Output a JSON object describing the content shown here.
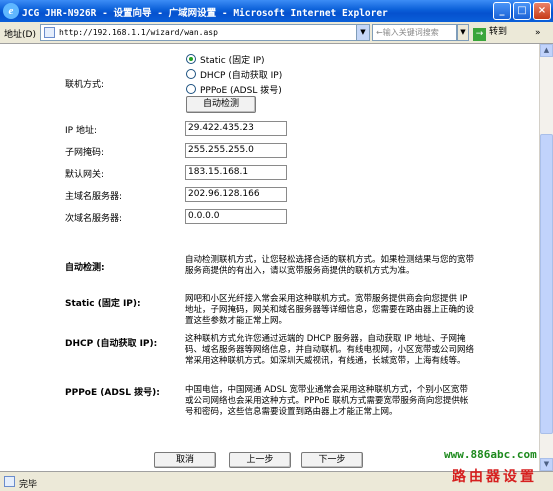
{
  "window": {
    "title": "JCG JHR-N926R - 设置向导 - 广域网设置 - Microsoft Internet Explorer",
    "minimize": "_",
    "maximize": "□",
    "close": "×"
  },
  "addressbar": {
    "label": "地址(D)",
    "url": "http://192.168.1.1/wizard/wan.asp",
    "dropdown": "▼",
    "search_placeholder": "←输入关键词搜索",
    "search_dropdown": "▼",
    "go_label": "转到",
    "go_arrow": "→",
    "more": "»"
  },
  "form": {
    "connection_mode_label": "联机方式:",
    "options": [
      {
        "label": "Static (固定 IP)",
        "checked": true
      },
      {
        "label": "DHCP (自动获取 IP)",
        "checked": false
      },
      {
        "label": "PPPoE (ADSL 拨号)",
        "checked": false
      }
    ],
    "auto_detect_button": "自动检测",
    "fields": [
      {
        "label": "IP 地址:",
        "value": "29.422.435.23"
      },
      {
        "label": "子网掩码:",
        "value": "255.255.255.0"
      },
      {
        "label": "默认网关:",
        "value": "183.15.168.1"
      },
      {
        "label": "主域名服务器:",
        "value": "202.96.128.166"
      },
      {
        "label": "次域名服务器:",
        "value": "0.0.0.0"
      }
    ]
  },
  "help": [
    {
      "title": "自动检测:",
      "text": "自动检测联机方式，让您轻松选择合适的联机方式。如果检测结果与您的宽带服务商提供的有出入，请以宽带服务商提供的联机方式为准。"
    },
    {
      "title": "Static (固定 IP):",
      "text": "网吧和小区光纤接入常会采用这种联机方式。宽带服务提供商会向您提供 IP 地址，子网掩码，网关和域名服务器等详细信息，您需要在路由器上正确的设置这些参数才能正常上网。"
    },
    {
      "title": "DHCP (自动获取 IP):",
      "text": "这种联机方式允许您通过远端的 DHCP 服务器，自动获取 IP 地址、子网掩码、域名服务器等网络信息，并自动联机。有线电视网，小区宽带或公司网络常采用这种联机方式。如深圳天威视讯，有线通，长城宽带，上海有线等。"
    },
    {
      "title": "PPPoE (ADSL 拨号):",
      "text": "中国电信，中国网通 ADSL 宽带业通常会采用这种联机方式，个别小区宽带或公司网络也会采用这种方式。PPPoE 联机方式需要宽带服务商向您提供帐号和密码，这些信息需要设置到路由器上才能正常上网。"
    }
  ],
  "buttons": {
    "cancel": "取消",
    "previous": "上一步",
    "next": "下一步"
  },
  "statusbar": {
    "text": "完毕"
  },
  "watermark": {
    "url": "www.886abc.com",
    "text": "路由器设置"
  }
}
